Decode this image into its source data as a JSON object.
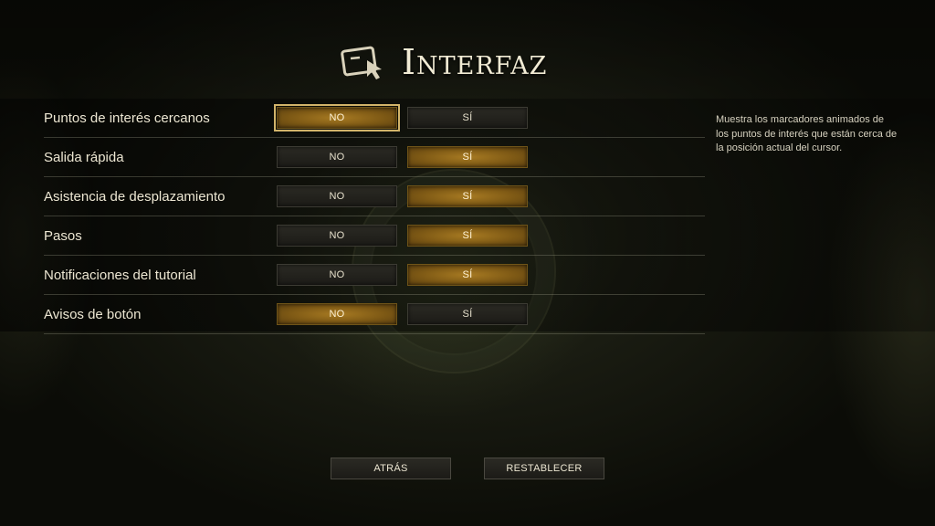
{
  "header": {
    "title": "Interfaz",
    "icon": "screen-cursor-icon"
  },
  "options": [
    {
      "label": "Puntos de interés cercanos",
      "no": "NO",
      "si": "SÍ",
      "selected": "no",
      "focused": true
    },
    {
      "label": "Salida rápida",
      "no": "NO",
      "si": "SÍ",
      "selected": "si",
      "focused": false
    },
    {
      "label": "Asistencia de desplazamiento",
      "no": "NO",
      "si": "SÍ",
      "selected": "si",
      "focused": false
    },
    {
      "label": "Pasos",
      "no": "NO",
      "si": "SÍ",
      "selected": "si",
      "focused": false
    },
    {
      "label": "Notificaciones del tutorial",
      "no": "NO",
      "si": "SÍ",
      "selected": "si",
      "focused": false
    },
    {
      "label": "Avisos de botón",
      "no": "NO",
      "si": "SÍ",
      "selected": "no",
      "focused": false
    }
  ],
  "description": "Muestra los marcadores animados de los puntos de interés que están cerca de la posición actual del cursor.",
  "footer": {
    "back_label": "ATRÁS",
    "reset_label": "RESTABLECER"
  },
  "colors": {
    "selected": "#8a6318",
    "focus_outline": "#d2b46a",
    "text": "#ece6d2"
  }
}
